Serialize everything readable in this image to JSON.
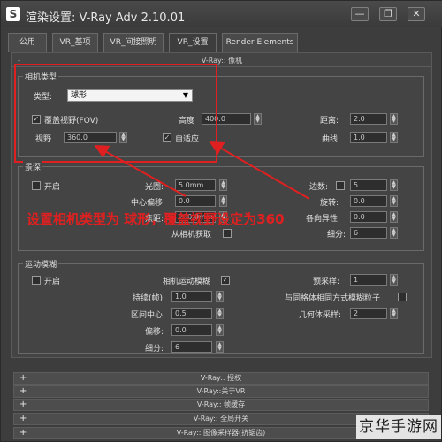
{
  "window": {
    "title": "渲染设置: V-Ray Adv 2.10.01",
    "app_icon": "3ds-max-icon"
  },
  "window_controls": {
    "minimize": "—",
    "restore": "❐",
    "close": "✕"
  },
  "tabs": [
    {
      "label": "公用"
    },
    {
      "label": "VR_基项"
    },
    {
      "label": "VR_间接照明"
    },
    {
      "label": "VR_设置"
    },
    {
      "label": "Render Elements"
    }
  ],
  "rollout_camera": {
    "header": "V-Ray:: 像机",
    "collapse": "-",
    "camera_type": {
      "group_title": "相机类型",
      "type_label": "类型:",
      "type_value": "球形",
      "override_fov_label": "覆盖视野(FOV)",
      "override_fov_checked": true,
      "fov_label": "视野",
      "fov_value": "360.0",
      "height_label": "高度",
      "height_value": "400.0",
      "auto_fit_label": "自适应",
      "auto_fit_checked": true,
      "distance_label": "距离:",
      "distance_value": "2.0",
      "curve_label": "曲线:",
      "curve_value": "1.0"
    },
    "dof": {
      "group_title": "景深",
      "on_label": "开启",
      "aperture_label": "光圈:",
      "aperture_value": "5.0mm",
      "center_bias_label": "中心偏移:",
      "center_bias_value": "0.0",
      "focal_label": "焦距:",
      "focal_value": "200.0mm",
      "get_from_camera_label": "从相机获取",
      "sides_label": "边数:",
      "sides_value": "5",
      "rotation_label": "旋转:",
      "rotation_value": "0.0",
      "anisotropy_label": "各向异性:",
      "anisotropy_value": "0.0",
      "subdivs_label": "细分:",
      "subdivs_value": "6"
    },
    "motion_blur": {
      "group_title": "运动模糊",
      "on_label": "开启",
      "camera_mb_label": "相机运动模糊",
      "camera_mb_checked": true,
      "duration_label": "持续(帧):",
      "duration_value": "1.0",
      "interval_center_label": "区间中心:",
      "interval_center_value": "0.5",
      "bias_label": "偏移:",
      "bias_value": "0.0",
      "subdivs_label": "细分:",
      "subdivs_value": "6",
      "prepass_label": "预采样:",
      "prepass_value": "1",
      "blur_particles_label": "与同格体相同方式模糊粒子",
      "geometry_samples_label": "几何体采样:",
      "geometry_samples_value": "2"
    }
  },
  "annotation": {
    "text": "设置相机类型为 球形，覆盖视野设定为360",
    "color": "#e02020"
  },
  "collapsed_rollouts": [
    {
      "label": "V-Ray:: 授权",
      "expand": "+"
    },
    {
      "label": "V-Ray::关于VR",
      "expand": "+"
    },
    {
      "label": "V-Ray:: 帧缓存",
      "expand": "+"
    },
    {
      "label": "V-Ray:: 全局开关",
      "expand": "+"
    },
    {
      "label": "V-Ray:: 图像采样器(抗锯齿)",
      "expand": "+"
    }
  ],
  "watermark": "京华手游网"
}
